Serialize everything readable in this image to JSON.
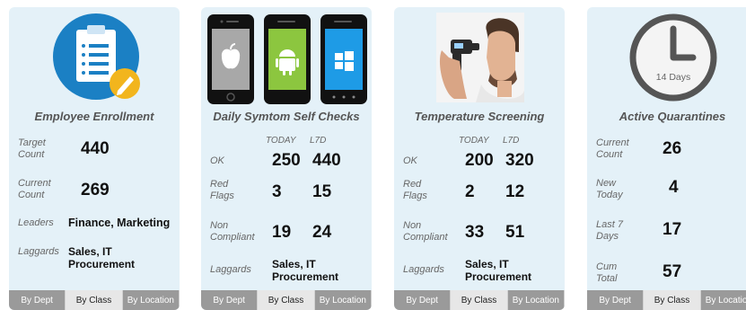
{
  "cards": [
    {
      "title": "Employee Enrollment",
      "rows": [
        {
          "label": "Target Count",
          "value": "440"
        },
        {
          "label": "Current Count",
          "value": "269"
        },
        {
          "label": "Leaders",
          "value": "Finance, Marketing"
        },
        {
          "label": "Laggards",
          "value": "Sales, IT Procurement"
        }
      ],
      "tabs": [
        "By Dept",
        "By Class",
        "By Location"
      ]
    },
    {
      "title": "Daily Symtom Self Checks",
      "col_today": "TODAY",
      "col_l7d": "L7D",
      "rows": [
        {
          "label": "OK",
          "today": "250",
          "l7d": "440"
        },
        {
          "label": "Red Flags",
          "today": "3",
          "l7d": "15"
        },
        {
          "label": "Non Compliant",
          "today": "19",
          "l7d": "24"
        },
        {
          "label": "Laggards",
          "value": "Sales, IT Procurement"
        }
      ],
      "tabs": [
        "By Dept",
        "By Class",
        "By Location"
      ]
    },
    {
      "title": "Temperature Screening",
      "col_today": "TODAY",
      "col_l7d": "L7D",
      "rows": [
        {
          "label": "OK",
          "today": "200",
          "l7d": "320"
        },
        {
          "label": "Red Flags",
          "today": "2",
          "l7d": "12"
        },
        {
          "label": "Non Compliant",
          "today": "33",
          "l7d": "51"
        },
        {
          "label": "Laggards",
          "value": "Sales, IT Procurement"
        }
      ],
      "tabs": [
        "By Dept",
        "By Class",
        "By Location"
      ]
    },
    {
      "title": "Active Quarantines",
      "clock_text": "14 Days",
      "rows": [
        {
          "label": "Current Count",
          "value": "26"
        },
        {
          "label": "New Today",
          "value": "4"
        },
        {
          "label": "Last 7 Days",
          "value": "17"
        },
        {
          "label": "Cum Total",
          "value": "57"
        }
      ],
      "tabs": [
        "By Dept",
        "By Class",
        "By Location"
      ]
    }
  ],
  "icons": [
    "clipboard-icon",
    "smartphones-icon",
    "temperature-screening-photo",
    "clock-icon"
  ],
  "colors": {
    "card_bg": "#e4f1f8",
    "tab_bg": "#9a9a9a",
    "tab_active_bg": "#e7e7e7",
    "clipboard_circle": "#1b80c4",
    "pencil_badge": "#f2b51d"
  }
}
